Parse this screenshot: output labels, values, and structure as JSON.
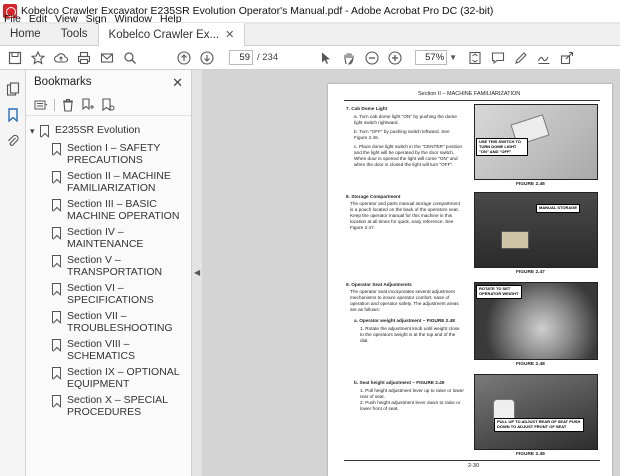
{
  "window": {
    "title": "Kobelco Crawler Excavator E235SR Evolution Operator's Manual.pdf - Adobe Acrobat Pro DC (32-bit)"
  },
  "menu": [
    "File",
    "Edit",
    "View",
    "Sign",
    "Window",
    "Help"
  ],
  "tabs": [
    {
      "label": "Home"
    },
    {
      "label": "Tools"
    },
    {
      "label": "Kobelco Crawler Ex..."
    }
  ],
  "toolbar": {
    "page_current": "59",
    "page_total": "/ 234",
    "zoom": "57%"
  },
  "bookmarks": {
    "title": "Bookmarks",
    "root": "E235SR Evolution",
    "items": [
      {
        "label": "Section I – SAFETY PRECAUTIONS"
      },
      {
        "label": "Section II – MACHINE FAMILIARIZATION"
      },
      {
        "label": "Section III – BASIC MACHINE OPERATION"
      },
      {
        "label": "Section IV – MAINTENANCE"
      },
      {
        "label": "Section V – TRANSPORTATION"
      },
      {
        "label": "Section VI – SPECIFICATIONS"
      },
      {
        "label": "Section VII – TROUBLESHOOTING"
      },
      {
        "label": "Section VIII – SCHEMATICS"
      },
      {
        "label": "Section IX – OPTIONAL EQUIPMENT"
      },
      {
        "label": "Section X – SPECIAL PROCEDURES"
      }
    ]
  },
  "doc": {
    "header": "Section II – MACHINE FAMILIARIZATION",
    "footer": "2-30",
    "s7_title": "7. Cab Dome Light",
    "s7_a": "a.  Turn cab dome light \"ON\" by pushing the dome light switch rightward.",
    "s7_b": "b.  Turn \"OFF\" by pushing switch leftward. See Figure 2.46.",
    "s7_c": "c.  Place dome light switch in the \"CENTER\" position and the light will be operated by the door switch. When door is opened the light will come \"ON\" and when the door is closed the light will turn \"OFF\".",
    "fig46_callout": "USE THIS SWITCH TO TURN DOME LIGHT \"ON\" AND \"OFF\"",
    "fig46": "FIGURE 2.46",
    "s8_title": "8. Storage Compartment",
    "s8_body": "The operator and parts manual storage compartment is a pouch located on the back of the operators seat. Keep the operator manual for this machine in this location at all times for quick, easy reference. See Figure 2.47.",
    "fig47_callout": "MANUAL STORAGE",
    "fig47": "FIGURE 2.47",
    "s9_title": "9. Operator Seat Adjustments",
    "s9_body": "The operator seat incorporates several adjustment mechanisms to insure operator comfort, ease of operation and operator safety. The adjustment areas are as follows:",
    "s9_a": "a.  Operator weight adjustment – FIGURE 2.48",
    "s9_a1": "1.  Rotate the adjustment knob until weight close to the operators weight is at the top and of the dial.",
    "fig48_callout": "ROTATE TO SET OPERATOR WEIGHT",
    "fig48": "FIGURE 2.48",
    "s9_b": "b.  Seat height adjustment – FIGURE 2.49",
    "s9_b1": "1.  Pull height adjustment lever up to raise or lower rear of seat.",
    "s9_b2": "2.  Push height adjustment lever down to raise or lower front of seat.",
    "fig49_callout": "PULL UP TO ADJUST REAR OF SEAT PUSH DOWN TO ADJUST FRONT OF SEAT",
    "fig49": "FIGURE 2.49"
  }
}
